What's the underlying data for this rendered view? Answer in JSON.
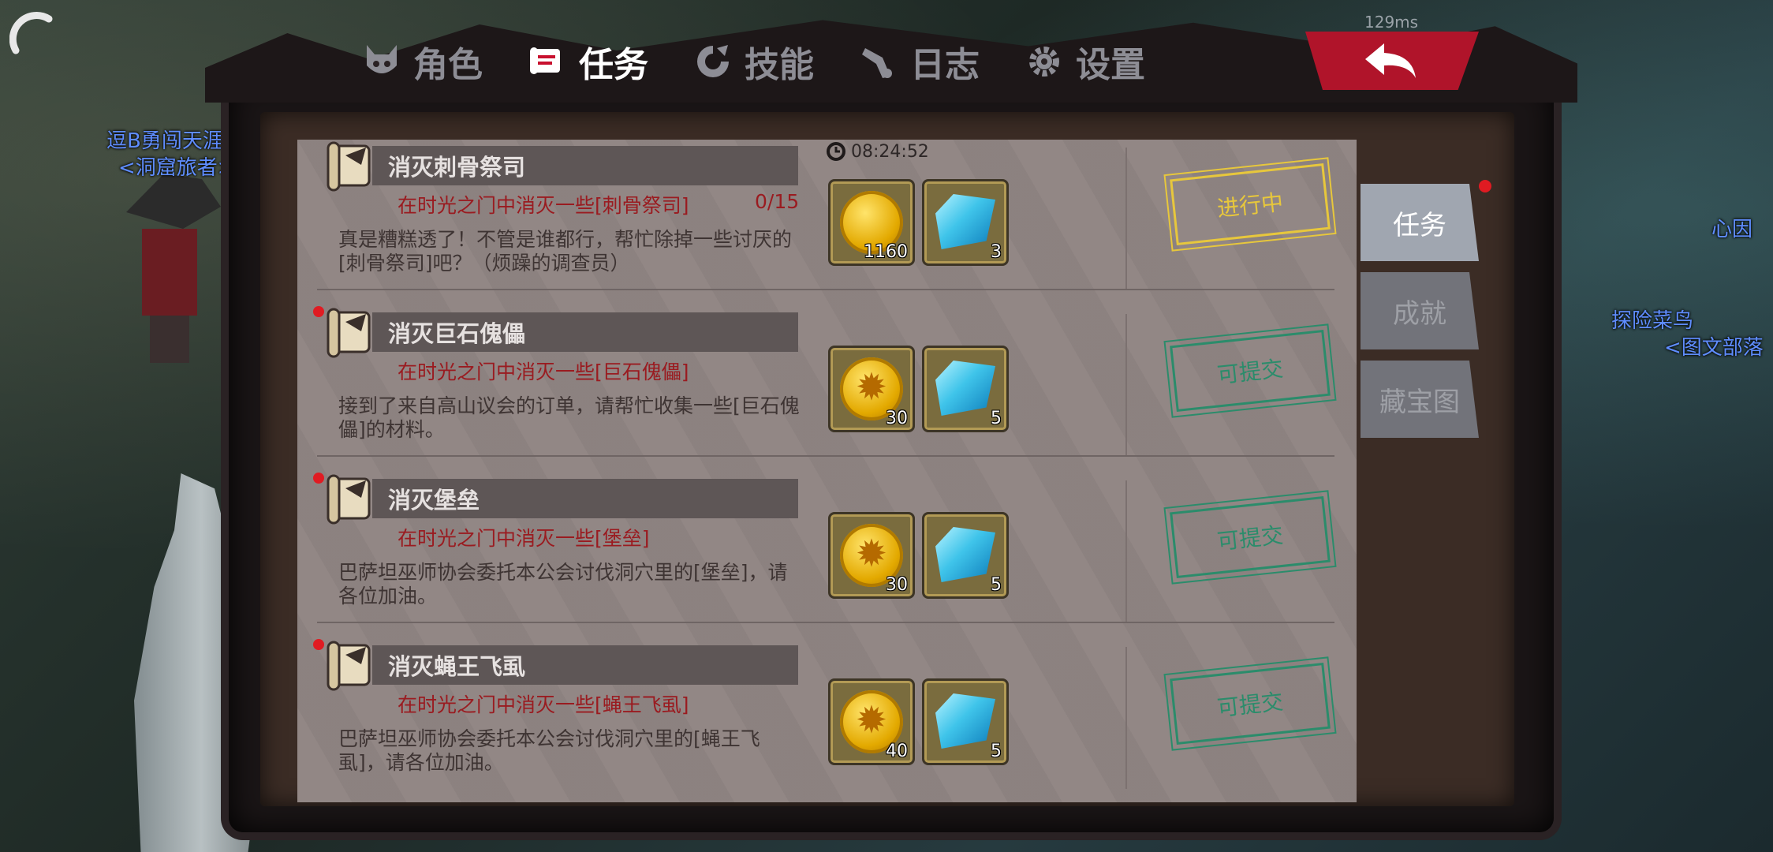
{
  "ping": "129ms",
  "npc_labels": {
    "left_title": "逗B勇闯天涯",
    "left_guild": "<洞窟旅者>",
    "right_partial_1": "心因",
    "right_title": "探险菜鸟",
    "right_guild": "<图文部落"
  },
  "tabs": [
    {
      "label": "角色",
      "icon": "demon-face-icon"
    },
    {
      "label": "任务",
      "icon": "scroll-icon",
      "active": true
    },
    {
      "label": "技能",
      "icon": "skill-swirl-icon"
    },
    {
      "label": "日志",
      "icon": "horn-icon"
    },
    {
      "label": "设置",
      "icon": "gear-icon"
    }
  ],
  "back_button_icon": "return-arrow-icon",
  "quests": [
    {
      "title": "消灭刺骨祭司",
      "objective": "在时光之门中消灭一些[刺骨祭司]",
      "progress": "0/15",
      "timer": "08:24:52",
      "description": "真是糟糕透了！不管是谁都行，帮忙除掉一些讨厌的[刺骨祭司]吧？（烦躁的调查员）",
      "rewards": [
        {
          "type": "gold-coin",
          "count": "1160"
        },
        {
          "type": "blue-crystal",
          "count": "3"
        }
      ],
      "status": "进行中",
      "has_alert": false
    },
    {
      "title": "消灭巨石傀儡",
      "objective": "在时光之门中消灭一些[巨石傀儡]",
      "progress": "",
      "timer": "",
      "description": "接到了来自高山议会的订单，请帮忙收集一些[巨石傀儡]的材料。",
      "rewards": [
        {
          "type": "sun-coin",
          "count": "30"
        },
        {
          "type": "blue-crystal",
          "count": "5"
        }
      ],
      "status": "可提交",
      "has_alert": true
    },
    {
      "title": "消灭堡垒",
      "objective": "在时光之门中消灭一些[堡垒]",
      "progress": "",
      "timer": "",
      "description": "巴萨坦巫师协会委托本公会讨伐洞穴里的[堡垒]，请各位加油。",
      "rewards": [
        {
          "type": "sun-coin",
          "count": "30"
        },
        {
          "type": "blue-crystal",
          "count": "5"
        }
      ],
      "status": "可提交",
      "has_alert": true
    },
    {
      "title": "消灭蝇王飞虱",
      "objective": "在时光之门中消灭一些[蝇王飞虱]",
      "progress": "",
      "timer": "",
      "description": "巴萨坦巫师协会委托本公会讨伐洞穴里的[蝇王飞虱]，请各位加油。",
      "rewards": [
        {
          "type": "sun-coin",
          "count": "40"
        },
        {
          "type": "blue-crystal",
          "count": "5"
        }
      ],
      "status": "可提交",
      "has_alert": true
    }
  ],
  "side_tabs": [
    {
      "label": "任务",
      "active": true
    },
    {
      "label": "成就",
      "active": false
    },
    {
      "label": "藏宝图",
      "active": false
    }
  ],
  "colors": {
    "accent_red": "#c8102e",
    "in_progress": "#e7c73c",
    "submittable": "#2b8c6b",
    "objective_text": "#9a1b20"
  }
}
